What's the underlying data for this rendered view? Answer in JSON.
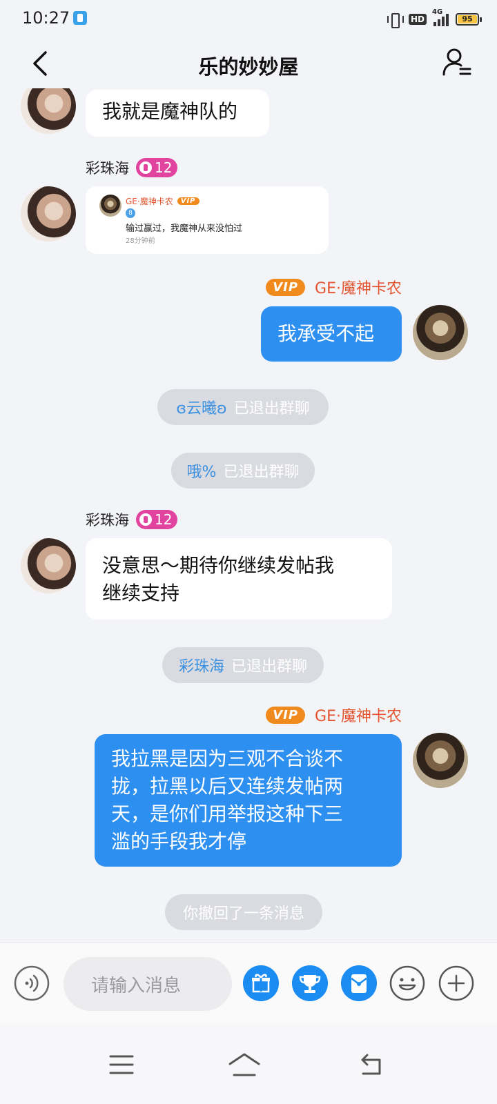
{
  "status_bar": {
    "time": "10:27",
    "hd": "HD",
    "network": "4G",
    "battery": "95"
  },
  "header": {
    "title": "乐的妙妙屋"
  },
  "messages": {
    "m1": {
      "text": "我就是魔神队的"
    },
    "m2": {
      "sender": "彩珠海",
      "level": "12",
      "card": {
        "name": "GE·魔神卡农",
        "vip": "VIP",
        "level": "8",
        "text": "输过赢过，我魔神从来没怕过",
        "time": "28分钟前"
      }
    },
    "m3": {
      "sender": "GE·魔神卡农",
      "vip": "VIP",
      "text": "我承受不起"
    },
    "sys1": {
      "name": "ɞ云曦ʚ",
      "text": "已退出群聊"
    },
    "sys2": {
      "name": "哦%",
      "text": "已退出群聊"
    },
    "m4": {
      "sender": "彩珠海",
      "level": "12",
      "line1": "没意思～期待你继续发帖我",
      "line2": "继续支持"
    },
    "sys3": {
      "name": "彩珠海",
      "text": "已退出群聊"
    },
    "m5": {
      "sender": "GE·魔神卡农",
      "vip": "VIP",
      "line1": "我拉黑是因为三观不合谈不",
      "line2": "拢，拉黑以后又连续发帖两",
      "line3": "天，是你们用举报这种下三",
      "line4": "滥的手段我才停"
    },
    "sys4": {
      "text": "你撤回了一条消息"
    }
  },
  "input": {
    "placeholder": "请输入消息"
  },
  "colors": {
    "outgoing_bubble": "#2d8ff0",
    "incoming_bubble": "#ffffff",
    "background": "#f3f4f7",
    "vip": "#f08a1c",
    "sender_name_me": "#e3542f",
    "level_badge": "#e0449e"
  },
  "icons": {
    "voice": "voice-icon",
    "gift": "gift-icon",
    "trophy": "trophy-icon",
    "redpacket": "red-packet-icon",
    "emoji": "emoji-icon",
    "add": "plus-icon"
  }
}
